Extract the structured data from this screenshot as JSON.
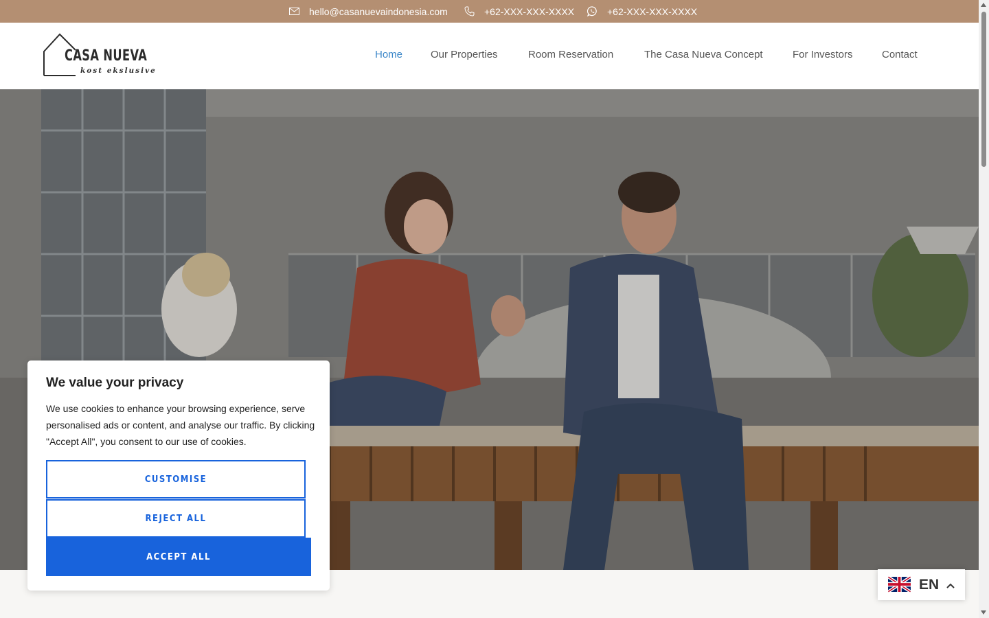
{
  "topbar": {
    "email": "hello@casanuevaindonesia.com",
    "phone": "+62-XXX-XXX-XXXX",
    "whatsapp": "+62-XXX-XXX-XXXX",
    "background_color": "#b48f72",
    "icons": [
      "mail-icon",
      "phone-icon",
      "whatsapp-icon"
    ]
  },
  "logo": {
    "name": "CASA NUEVA",
    "tagline": "kost ekslusive"
  },
  "nav": {
    "items": [
      {
        "label": "Home",
        "active": true
      },
      {
        "label": "Our Properties",
        "active": false
      },
      {
        "label": "Room Reservation",
        "active": false
      },
      {
        "label": "The Casa Nueva Concept",
        "active": false
      },
      {
        "label": "For Investors",
        "active": false
      },
      {
        "label": "Contact",
        "active": false
      }
    ],
    "active_color": "#3a86c8"
  },
  "cookie_banner": {
    "title": "We value your privacy",
    "body": "We use cookies to enhance your browsing experience, serve personalised ads or content, and analyse our traffic. By clicking \"Accept All\", you consent to our use of cookies.",
    "customise_label": "CUSTOMISE",
    "reject_label": "REJECT ALL",
    "accept_label": "ACCEPT ALL",
    "accent_color": "#1863dc"
  },
  "language": {
    "code": "EN",
    "flag": "uk-flag-icon"
  }
}
